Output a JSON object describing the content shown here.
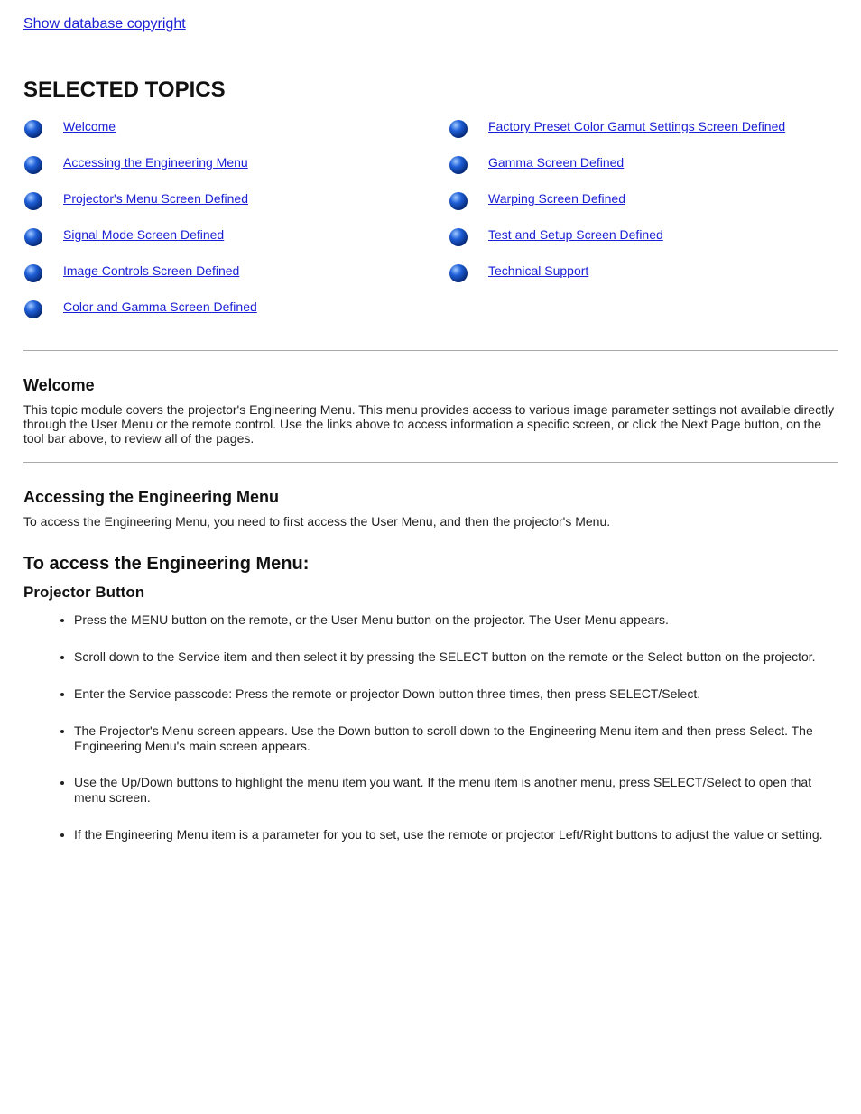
{
  "header": {
    "database_link": "Show database copyright"
  },
  "title": "SELECTED TOPICS",
  "toc": {
    "left": [
      {
        "label": "Welcome"
      },
      {
        "label": "Accessing the Engineering Menu"
      },
      {
        "label": "Projector's Menu Screen Defined"
      },
      {
        "label": "Signal Mode Screen Defined"
      },
      {
        "label": "Image Controls Screen Defined"
      },
      {
        "label": "Color and Gamma Screen Defined"
      }
    ],
    "right": [
      {
        "label": "Factory Preset Color Gamut Settings Screen Defined"
      },
      {
        "label": "Gamma Screen Defined"
      },
      {
        "label": "Warping Screen Defined"
      },
      {
        "label": "Test and Setup Screen Defined"
      },
      {
        "label": "Technical Support"
      }
    ]
  },
  "welcome": {
    "heading": "Welcome",
    "body": "This topic module covers the projector's Engineering Menu. This menu provides access to various image parameter settings not available directly through the User Menu or the remote control. Use the links above to access information a specific screen, or click the Next Page button, on the tool bar above, to review all of the pages."
  },
  "access": {
    "heading": "Accessing the Engineering Menu",
    "body": "To access the Engineering Menu, you need to first access the User Menu, and then the projector's Menu.",
    "to_access_heading": "To access the Engineering Menu:",
    "list_heading": "Projector Button",
    "items": [
      "Press the MENU button on the remote, or the User Menu button on the projector. The User Menu appears.",
      "Scroll down to the Service item and then select it by pressing the SELECT button on the remote or the Select button on the projector.",
      "Enter the Service passcode: Press the remote or projector Down button three times, then press SELECT/Select.",
      "The Projector's Menu screen appears. Use the Down button to scroll down to the Engineering Menu item and then press Select. The Engineering Menu's main screen appears.",
      "Use the Up/Down buttons to highlight the menu item you want. If the menu item is another menu, press SELECT/Select to open that menu screen.",
      "If the Engineering Menu item is a parameter for you to set, use the remote or projector Left/Right buttons to adjust the value or setting."
    ]
  }
}
